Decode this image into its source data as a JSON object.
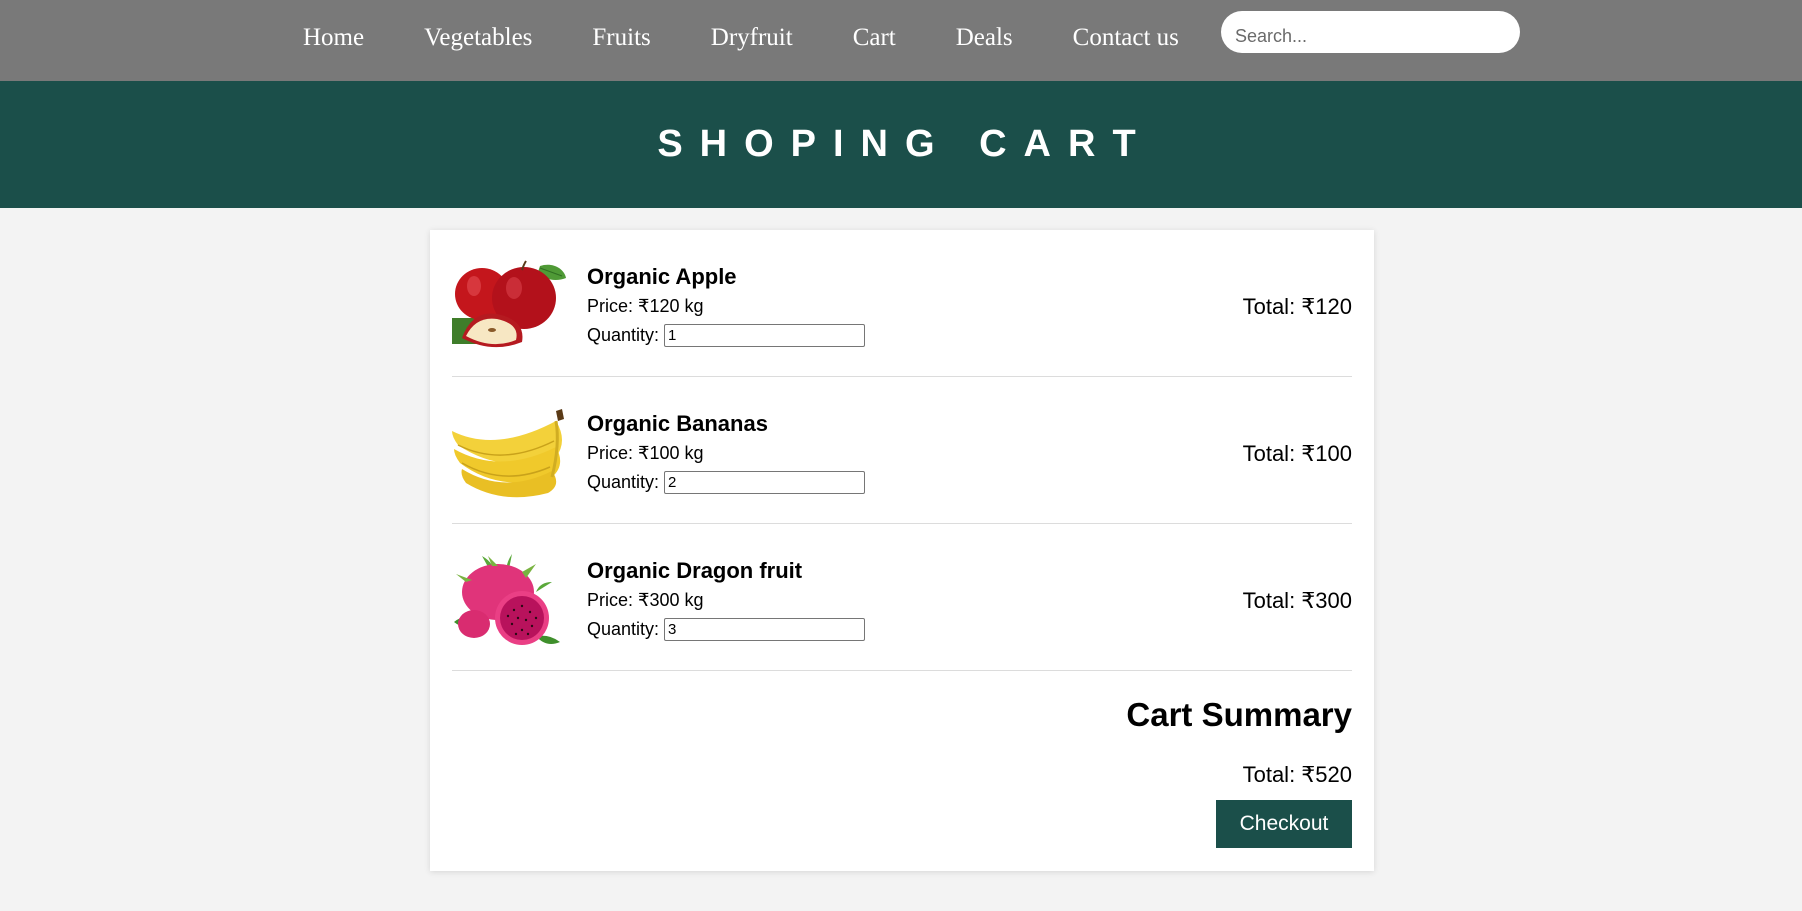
{
  "nav": {
    "links": [
      "Home",
      "Vegetables",
      "Fruits",
      "Dryfruit",
      "Cart",
      "Deals",
      "Contact us"
    ],
    "search_placeholder": "Search..."
  },
  "banner": {
    "title": "SHOPING CART"
  },
  "cart": {
    "items": [
      {
        "name": "Organic Apple",
        "price": "Price: ₹120 kg",
        "qty_label": "Quantity:",
        "qty": "1",
        "total": "Total: ₹120",
        "image": "apple-image"
      },
      {
        "name": "Organic Bananas",
        "price": "Price: ₹100 kg",
        "qty_label": "Quantity:",
        "qty": "2",
        "total": "Total: ₹100",
        "image": "bananas-image"
      },
      {
        "name": "Organic Dragon fruit",
        "price": "Price: ₹300 kg",
        "qty_label": "Quantity:",
        "qty": "3",
        "total": "Total: ₹300",
        "image": "dragon-fruit-image"
      }
    ],
    "summary": {
      "title": "Cart Summary",
      "total": "Total: ₹520",
      "checkout_label": "Checkout"
    }
  },
  "colors": {
    "nav_bg": "#797979",
    "accent": "#1b4f4a",
    "page_bg": "#f3f3f3"
  }
}
